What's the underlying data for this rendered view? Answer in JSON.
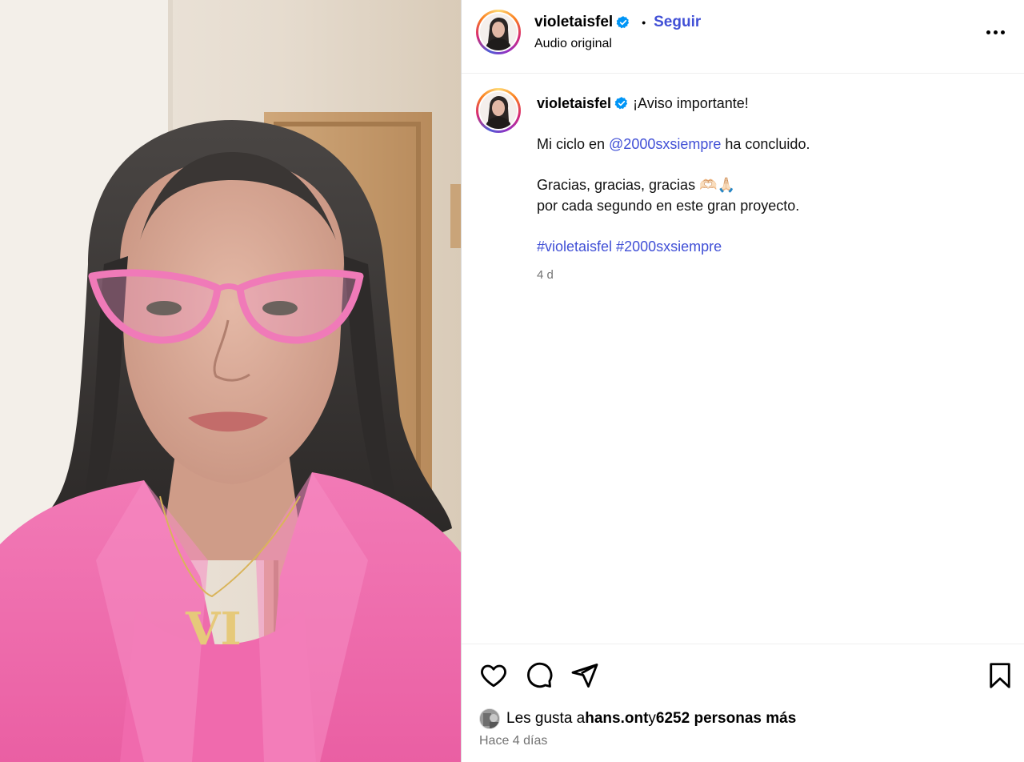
{
  "post": {
    "username": "violetaisfel",
    "follow_label": "Seguir",
    "header_separator": "•",
    "audio_label": "Audio original"
  },
  "caption": {
    "username": "violetaisfel",
    "line1": "¡Aviso importante!",
    "line2_prefix": "Mi ciclo en ",
    "line2_mention": "@2000sxsiempre",
    "line2_suffix": " ha concluido.",
    "line3": "Gracias, gracias, gracias 🫶🏻🙏🏻",
    "line4": "por cada segundo en este gran proyecto.",
    "hashtags": "#violetaisfel #2000sxsiempre",
    "age": "4 d"
  },
  "engagement": {
    "likes_prefix": "Les gusta a ",
    "liker": "hans.ont",
    "likes_mid": " y ",
    "likes_count": "6252 personas más",
    "time_ago": "Hace 4 días"
  },
  "icons": {
    "like": "heart-icon",
    "comment": "comment-icon",
    "share": "send-icon",
    "save": "bookmark-icon",
    "more": "more-options-icon",
    "verified": "verified-badge-icon"
  },
  "colors": {
    "link": "#4150d6",
    "verified": "#0095f6",
    "muted": "#737373"
  }
}
